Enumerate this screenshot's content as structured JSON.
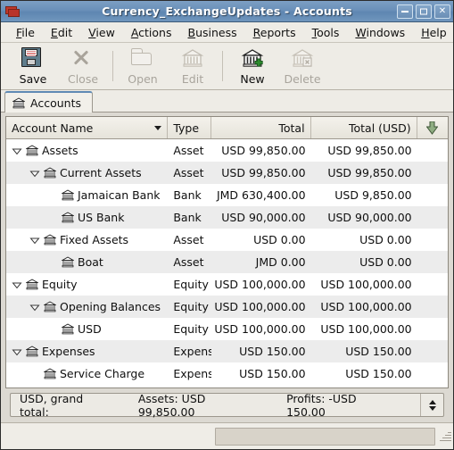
{
  "window": {
    "title": "Currency_ExchangeUpdates - Accounts",
    "app_icon": "gnucash-icon",
    "buttons": {
      "minimize": "minimize-button",
      "maximize": "maximize-button",
      "close": "close-button"
    }
  },
  "menubar": {
    "items": [
      {
        "label": "File",
        "mnemonic": "F"
      },
      {
        "label": "Edit",
        "mnemonic": "E"
      },
      {
        "label": "View",
        "mnemonic": "V"
      },
      {
        "label": "Actions",
        "mnemonic": "A"
      },
      {
        "label": "Business",
        "mnemonic": "B"
      },
      {
        "label": "Reports",
        "mnemonic": "R"
      },
      {
        "label": "Tools",
        "mnemonic": "T"
      },
      {
        "label": "Windows",
        "mnemonic": "W"
      },
      {
        "label": "Help",
        "mnemonic": "H"
      }
    ]
  },
  "toolbar": {
    "buttons": [
      {
        "label": "Save",
        "icon": "floppy-disk-icon",
        "enabled": true
      },
      {
        "label": "Close",
        "icon": "close-x-icon",
        "enabled": false
      },
      {
        "label": "Open",
        "icon": "folder-open-icon",
        "enabled": false
      },
      {
        "label": "Edit",
        "icon": "bank-edit-icon",
        "enabled": false
      },
      {
        "label": "New",
        "icon": "bank-plus-icon",
        "enabled": true
      },
      {
        "label": "Delete",
        "icon": "bank-delete-icon",
        "enabled": false
      }
    ]
  },
  "tabs": [
    {
      "label": "Accounts",
      "icon": "bank-icon",
      "active": true
    }
  ],
  "accounts_table": {
    "columns": [
      {
        "label": "Account Name",
        "key": "name",
        "sort_indicator": "chevron-down-icon"
      },
      {
        "label": "Type",
        "key": "type"
      },
      {
        "label": "Total",
        "key": "total"
      },
      {
        "label": "Total (USD)",
        "key": "total_usd"
      },
      {
        "label": "",
        "key": "options",
        "icon": "arrow-down-green-icon"
      }
    ],
    "rows": [
      {
        "name": "Assets",
        "depth": 0,
        "expander": "expanded",
        "type": "Asset",
        "total": "USD 99,850.00",
        "total_usd": "USD 99,850.00"
      },
      {
        "name": "Current Assets",
        "depth": 1,
        "expander": "expanded",
        "type": "Asset",
        "total": "USD 99,850.00",
        "total_usd": "USD 99,850.00"
      },
      {
        "name": "Jamaican Bank",
        "depth": 2,
        "expander": "none",
        "type": "Bank",
        "total": "JMD 630,400.00",
        "total_usd": "USD 9,850.00"
      },
      {
        "name": "US Bank",
        "depth": 2,
        "expander": "none",
        "type": "Bank",
        "total": "USD 90,000.00",
        "total_usd": "USD 90,000.00"
      },
      {
        "name": "Fixed Assets",
        "depth": 1,
        "expander": "expanded",
        "type": "Asset",
        "total": "USD 0.00",
        "total_usd": "USD 0.00"
      },
      {
        "name": "Boat",
        "depth": 2,
        "expander": "none",
        "type": "Asset",
        "total": "JMD 0.00",
        "total_usd": "USD 0.00"
      },
      {
        "name": "Equity",
        "depth": 0,
        "expander": "expanded",
        "type": "Equity",
        "total": "USD 100,000.00",
        "total_usd": "USD 100,000.00"
      },
      {
        "name": "Opening Balances",
        "depth": 1,
        "expander": "expanded",
        "type": "Equity",
        "total": "USD 100,000.00",
        "total_usd": "USD 100,000.00"
      },
      {
        "name": "USD",
        "depth": 2,
        "expander": "none",
        "type": "Equity",
        "total": "USD 100,000.00",
        "total_usd": "USD 100,000.00"
      },
      {
        "name": "Expenses",
        "depth": 0,
        "expander": "expanded",
        "type": "Expens",
        "total": "USD 150.00",
        "total_usd": "USD 150.00"
      },
      {
        "name": "Service Charge",
        "depth": 1,
        "expander": "none",
        "type": "Expens",
        "total": "USD 150.00",
        "total_usd": "USD 150.00"
      }
    ]
  },
  "summary_bar": {
    "currency_label": "USD, grand total:",
    "assets": "Assets: USD 99,850.00",
    "profits": "Profits: -USD 150.00",
    "spinner": "spin-up-down-icon"
  },
  "statusbar": {
    "text": "",
    "progress": ""
  },
  "colors": {
    "titlebar": "#6a90b9",
    "chrome": "#eeece6",
    "row_alt": "#ececec",
    "accent_green": "#7d9d70",
    "tab_accent": "#5f8ab4"
  }
}
